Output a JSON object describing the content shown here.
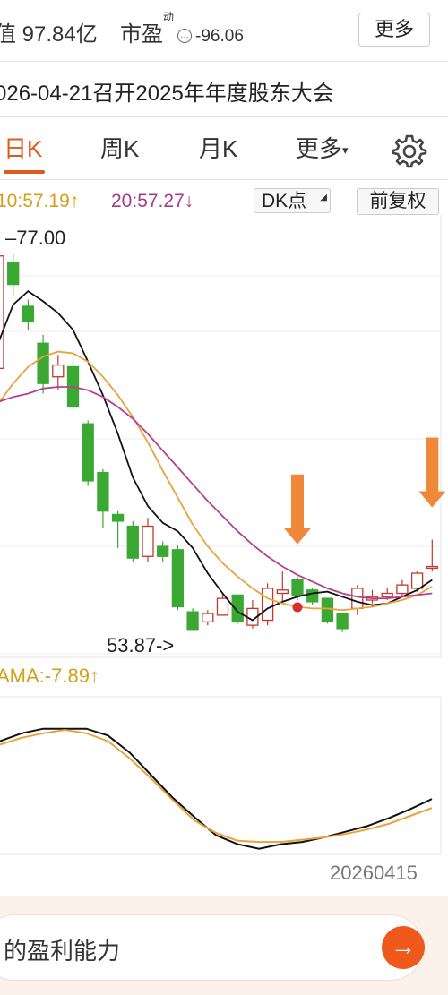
{
  "header": {
    "market_cap": "值 97.84亿",
    "pe_label": "市盈",
    "pe_superscript": "动",
    "pe_info_icon": "info-icon",
    "pe_value": "-96.06",
    "more_label": "更多"
  },
  "notice": "026-04-21召开2025年年度股东大会",
  "tabs": [
    {
      "label": "日K",
      "active": true
    },
    {
      "label": "周K",
      "active": false
    },
    {
      "label": "月K",
      "active": false
    },
    {
      "label": "更多",
      "active": false
    }
  ],
  "tab_more_caret": "▾",
  "settings_icon": "gear-icon",
  "ma_line": {
    "ma_a": "10:57.19↑",
    "ma_b": "20:57.27↓",
    "dk_label": "DK点",
    "fq_label": "前复权"
  },
  "colors": {
    "up": "#c0392b",
    "down": "#3aa832",
    "ma5": "#111111",
    "ma10": "#e8a33a",
    "ma20": "#b5408f",
    "arrow": "#f0883a",
    "accent": "#e05a1a"
  },
  "chart_data": {
    "type": "candlestick",
    "high_label": "77.00",
    "low_label": "53.87->",
    "ylim": [
      52.5,
      78.0
    ],
    "candles": [
      {
        "o": 69.5,
        "c": 76.2,
        "h": 77.0,
        "l": 69.0
      },
      {
        "o": 75.8,
        "c": 74.5,
        "h": 76.3,
        "l": 73.8
      },
      {
        "o": 73.2,
        "c": 72.3,
        "h": 73.6,
        "l": 71.8
      },
      {
        "o": 71.0,
        "c": 68.6,
        "h": 71.5,
        "l": 68.0
      },
      {
        "o": 69.0,
        "c": 69.7,
        "h": 70.3,
        "l": 68.2
      },
      {
        "o": 69.6,
        "c": 67.2,
        "h": 70.3,
        "l": 67.0
      },
      {
        "o": 66.2,
        "c": 62.8,
        "h": 66.4,
        "l": 62.5
      },
      {
        "o": 63.3,
        "c": 61.0,
        "h": 63.5,
        "l": 60.0
      },
      {
        "o": 60.8,
        "c": 60.4,
        "h": 61.0,
        "l": 58.8
      },
      {
        "o": 60.1,
        "c": 58.2,
        "h": 60.4,
        "l": 58.0
      },
      {
        "o": 58.3,
        "c": 60.1,
        "h": 60.6,
        "l": 58.0
      },
      {
        "o": 58.9,
        "c": 58.3,
        "h": 59.2,
        "l": 58.0
      },
      {
        "o": 58.7,
        "c": 55.3,
        "h": 59.0,
        "l": 55.1
      },
      {
        "o": 55.0,
        "c": 53.9,
        "h": 55.2,
        "l": 53.87
      },
      {
        "o": 54.4,
        "c": 54.9,
        "h": 55.1,
        "l": 54.2
      },
      {
        "o": 54.8,
        "c": 55.8,
        "h": 56.1,
        "l": 54.8
      },
      {
        "o": 56.0,
        "c": 54.4,
        "h": 56.0,
        "l": 54.3
      },
      {
        "o": 54.2,
        "c": 55.2,
        "h": 55.7,
        "l": 54.0
      },
      {
        "o": 54.5,
        "c": 56.4,
        "h": 56.7,
        "l": 54.2
      },
      {
        "o": 56.1,
        "c": 56.3,
        "h": 57.4,
        "l": 55.6
      },
      {
        "o": 56.9,
        "c": 56.0,
        "h": 57.1,
        "l": 55.7
      },
      {
        "o": 56.3,
        "c": 55.6,
        "h": 56.4,
        "l": 55.4
      },
      {
        "o": 55.8,
        "c": 54.4,
        "h": 55.8,
        "l": 54.3
      },
      {
        "o": 54.9,
        "c": 54.0,
        "h": 54.9,
        "l": 53.8
      },
      {
        "o": 55.2,
        "c": 56.4,
        "h": 56.6,
        "l": 54.8
      },
      {
        "o": 55.7,
        "c": 55.9,
        "h": 56.3,
        "l": 55.5
      },
      {
        "o": 55.9,
        "c": 56.1,
        "h": 56.4,
        "l": 55.7
      },
      {
        "o": 56.1,
        "c": 56.6,
        "h": 56.9,
        "l": 55.9
      },
      {
        "o": 56.4,
        "c": 57.3,
        "h": 57.4,
        "l": 56.2
      },
      {
        "o": 57.6,
        "c": 57.7,
        "h": 59.3,
        "l": 57.4
      }
    ],
    "ma_lines": [
      {
        "name": "MA5",
        "values": [
          71.0,
          73.3,
          74.1,
          73.5,
          72.8,
          71.8,
          69.9,
          67.9,
          65.6,
          63.0,
          61.3,
          60.3,
          59.8,
          58.8,
          57.3,
          56.1,
          55.0,
          54.5,
          55.2,
          55.6,
          55.9,
          56.1,
          56.2,
          55.9,
          55.6,
          55.4,
          55.5,
          55.9,
          56.3,
          56.9
        ]
      },
      {
        "name": "MA10",
        "values": [
          67.4,
          68.6,
          69.6,
          70.2,
          70.5,
          70.4,
          69.9,
          69.0,
          67.9,
          66.6,
          65.1,
          63.4,
          61.8,
          60.2,
          58.9,
          57.9,
          57.1,
          56.4,
          55.8,
          55.5,
          55.3,
          55.2,
          55.2,
          55.1,
          55.2,
          55.3,
          55.5,
          55.7,
          56.0,
          56.5
        ]
      },
      {
        "name": "MA20",
        "values": [
          67.5,
          67.8,
          68.0,
          68.3,
          68.4,
          68.4,
          68.2,
          67.8,
          67.2,
          66.5,
          65.6,
          64.6,
          63.6,
          62.6,
          61.6,
          60.7,
          59.8,
          59.0,
          58.3,
          57.7,
          57.2,
          56.8,
          56.4,
          56.1,
          55.9,
          55.8,
          55.8,
          55.9,
          56.0,
          56.1
        ]
      }
    ],
    "markers": [
      {
        "type": "down-arrow",
        "candle": 20
      },
      {
        "type": "down-arrow",
        "candle": 29
      },
      {
        "type": "dot",
        "candle": 20
      }
    ],
    "subchart": {
      "label": "AMA:-7.89↑",
      "date_label": "20260415",
      "lines": [
        {
          "name": "black",
          "values": [
            0.5,
            1.2,
            1.6,
            1.6,
            1.6,
            1.0,
            -0.5,
            -2.5,
            -4.5,
            -6.2,
            -7.8,
            -8.6,
            -9.0,
            -8.6,
            -8.4,
            -8.0,
            -7.5,
            -7.0,
            -6.3,
            -5.5,
            -4.6
          ]
        },
        {
          "name": "orange",
          "values": [
            0.2,
            0.8,
            1.2,
            1.5,
            1.2,
            0.5,
            -1.0,
            -2.8,
            -4.7,
            -6.5,
            -7.6,
            -8.3,
            -8.4,
            -8.4,
            -8.2,
            -8.0,
            -7.7,
            -7.3,
            -6.8,
            -6.1,
            -5.4
          ]
        }
      ],
      "ylim": [
        -9.5,
        3.0
      ]
    }
  },
  "input": {
    "text": "的盈利能力",
    "send_icon": "arrow-right-icon"
  }
}
